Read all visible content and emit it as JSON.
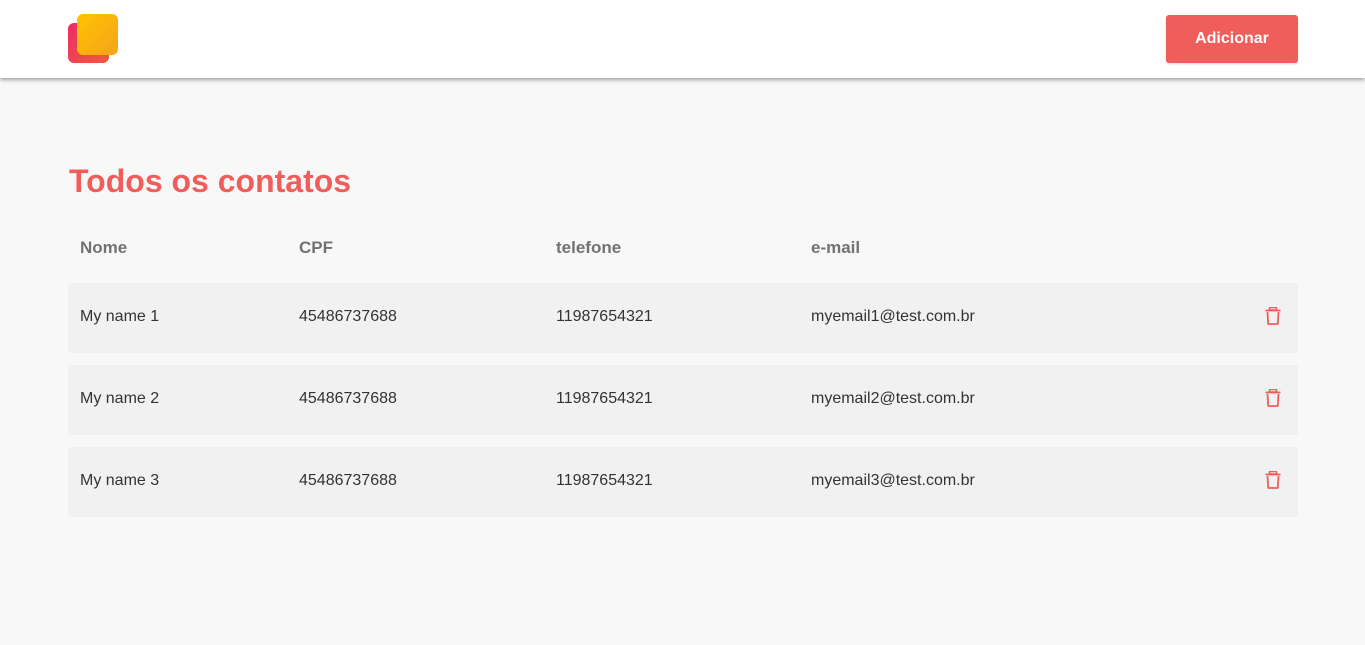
{
  "header": {
    "add_button_label": "Adicionar"
  },
  "colors": {
    "accent": "#ef5e5a",
    "logo_gradient_back": [
      "#ec2a6a",
      "#f25a3a"
    ],
    "logo_gradient_front": [
      "#ffc400",
      "#f7a21b"
    ]
  },
  "main": {
    "title": "Todos os contatos",
    "columns": [
      "Nome",
      "CPF",
      "telefone",
      "e-mail"
    ],
    "rows": [
      {
        "name": "My name 1",
        "cpf": "45486737688",
        "phone": "11987654321",
        "email": "myemail1@test.com.br",
        "action_icon": "trash-icon"
      },
      {
        "name": "My name 2",
        "cpf": "45486737688",
        "phone": "11987654321",
        "email": "myemail2@test.com.br",
        "action_icon": "trash-icon"
      },
      {
        "name": "My name 3",
        "cpf": "45486737688",
        "phone": "11987654321",
        "email": "myemail3@test.com.br",
        "action_icon": "trash-icon"
      }
    ]
  }
}
